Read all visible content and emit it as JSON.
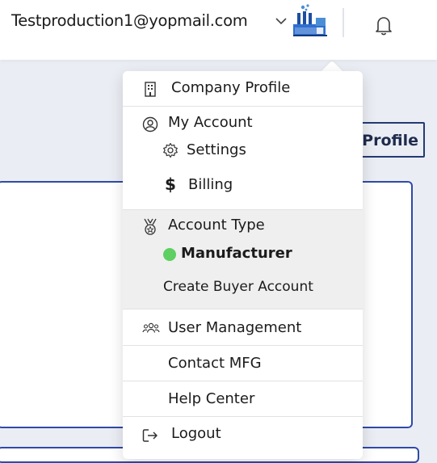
{
  "header": {
    "user_email": "Testproduction1@yopmail.com"
  },
  "page": {
    "view_profile_label": "View Profile"
  },
  "menu": {
    "company_profile": "Company Profile",
    "my_account": "My Account",
    "settings": "Settings",
    "billing": "Billing",
    "account_type": "Account Type",
    "current_account_type": "Manufacturer",
    "create_buyer_account": "Create Buyer Account",
    "user_management": "User Management",
    "contact_mfg": "Contact MFG",
    "help_center": "Help Center",
    "logout": "Logout"
  },
  "icons": {
    "header": [
      "chevron-down-icon",
      "factory-logo-icon",
      "bell-icon"
    ],
    "menu": [
      "building-icon",
      "user-circle-icon",
      "gear-icon",
      "dollar-icon",
      "medal-icon",
      "users-icon",
      "logout-icon"
    ]
  },
  "colors": {
    "brand_blue": "#2f4aa8",
    "dark_navy": "#243a73",
    "status_green": "#5ecf61",
    "page_background": "#eaedf3",
    "section_highlight": "#efefef"
  }
}
